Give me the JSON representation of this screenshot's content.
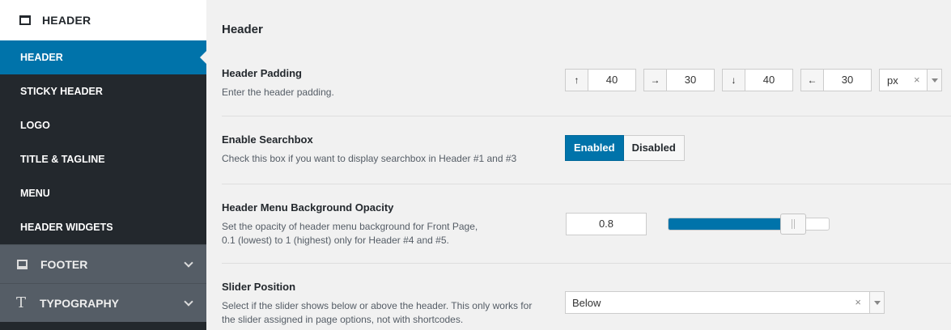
{
  "sidebar": {
    "section_label": "HEADER",
    "items": [
      {
        "label": "HEADER",
        "active": true
      },
      {
        "label": "STICKY HEADER"
      },
      {
        "label": "LOGO"
      },
      {
        "label": "TITLE & TAGLINE"
      },
      {
        "label": "MENU"
      },
      {
        "label": "HEADER WIDGETS"
      }
    ],
    "groups": [
      {
        "label": "FOOTER",
        "icon": "footer-icon"
      },
      {
        "label": "TYPOGRAPHY",
        "icon": "typography-icon",
        "glyph": "T"
      }
    ]
  },
  "main": {
    "title": "Header",
    "header_padding": {
      "title": "Header Padding",
      "desc": "Enter the header padding.",
      "top": "40",
      "right": "30",
      "bottom": "40",
      "left": "30",
      "unit": "px",
      "icons": {
        "top": "↑",
        "right": "→",
        "bottom": "↓",
        "left": "←"
      },
      "clear": "×"
    },
    "searchbox": {
      "title": "Enable Searchbox",
      "desc": "Check this box if you want to display searchbox in Header #1 and #3",
      "enabled_label": "Enabled",
      "disabled_label": "Disabled",
      "selected": "Enabled"
    },
    "opacity": {
      "title": "Header Menu Background Opacity",
      "desc_line1": "Set the opacity of header menu background for Front Page,",
      "desc_line2": "0.1 (lowest) to 1 (highest) only for Header #4 and #5.",
      "value": "0.8",
      "slider_fraction": 0.78
    },
    "slider_position": {
      "title": "Slider Position",
      "desc_line1": "Select if the slider shows below or above the header. This only works for",
      "desc_line2": "the slider assigned in page options, not with shortcodes.",
      "value": "Below",
      "clear": "×"
    }
  },
  "colors": {
    "accent": "#0073aa",
    "sidebar_dark": "#23282d",
    "sidebar_group": "#555d66"
  }
}
